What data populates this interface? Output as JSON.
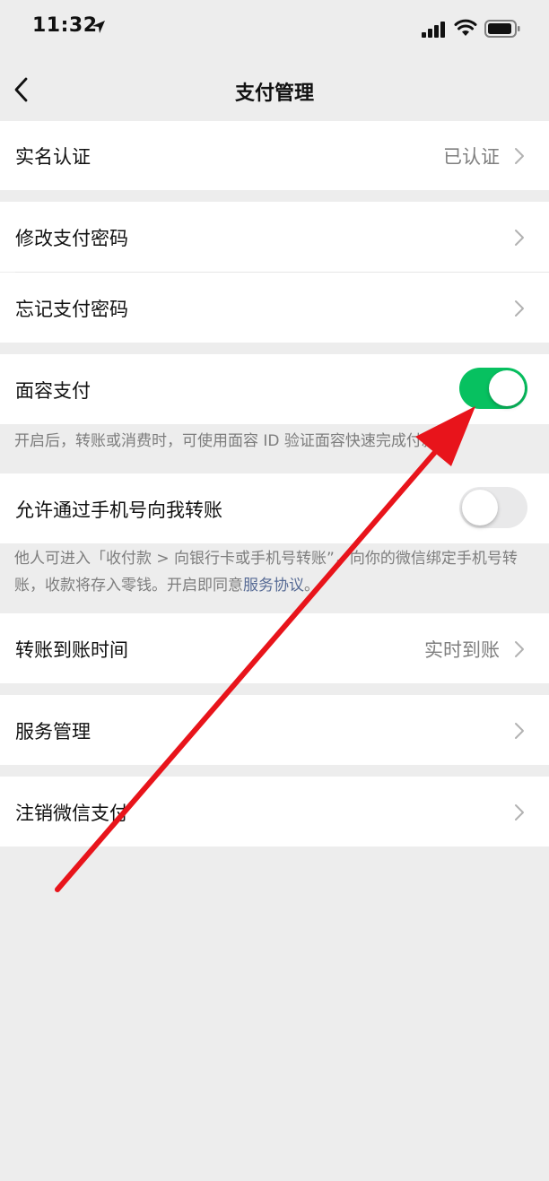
{
  "status_bar": {
    "time": "11:32",
    "icons": [
      "location-arrow-icon",
      "cellular-signal-icon",
      "wifi-icon",
      "battery-icon"
    ]
  },
  "nav": {
    "title": "支付管理",
    "back_icon": "chevron-left-icon"
  },
  "sections": {
    "real_name": {
      "label": "实名认证",
      "value": "已认证"
    },
    "change_password": {
      "label": "修改支付密码"
    },
    "forgot_password": {
      "label": "忘记支付密码"
    },
    "face_pay": {
      "label": "面容支付",
      "enabled": true,
      "note": "开启后，转账或消费时，可使用面容 ID 验证面容快速完成付款"
    },
    "phone_transfer": {
      "label": "允许通过手机号向我转账",
      "enabled": false,
      "note": "他人可进入「收付款 > 向银行卡或手机号转账”，向你的微信绑定手机号转账，收款将存入零钱。开启即同意",
      "link": "服务协议",
      "note_end": "。"
    },
    "arrival_time": {
      "label": "转账到账时间",
      "value": "实时到账"
    },
    "service_manage": {
      "label": "服务管理"
    },
    "cancel_wechat_pay": {
      "label": "注销微信支付"
    }
  },
  "colors": {
    "background": "#ededed",
    "toggle_on": "#07c160",
    "toggle_off": "#e9e9ea",
    "link": "#576b95",
    "annotation_arrow": "#e8141b"
  }
}
